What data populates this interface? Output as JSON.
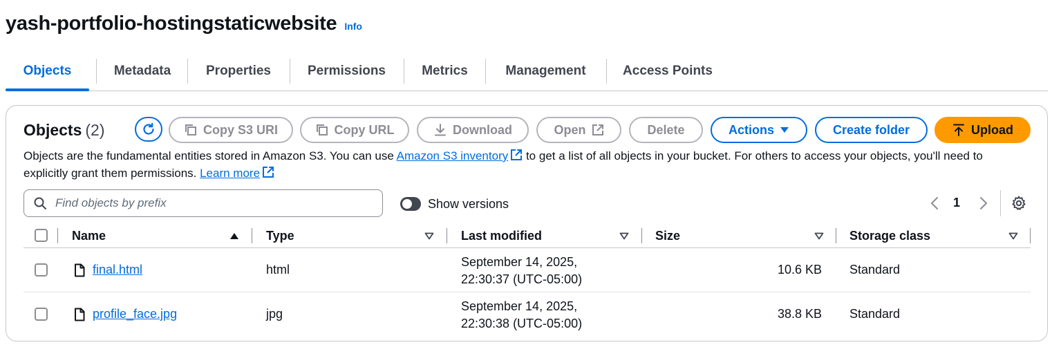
{
  "header": {
    "bucket_name": "yash-portfolio-hostingstaticwebsite",
    "info_label": "Info"
  },
  "tabs": [
    {
      "label": "Objects",
      "active": true
    },
    {
      "label": "Metadata",
      "active": false
    },
    {
      "label": "Properties",
      "active": false
    },
    {
      "label": "Permissions",
      "active": false
    },
    {
      "label": "Metrics",
      "active": false
    },
    {
      "label": "Management",
      "active": false
    },
    {
      "label": "Access Points",
      "active": false
    }
  ],
  "objects_panel": {
    "title": "Objects",
    "count": "(2)",
    "toolbar": {
      "copy_s3_uri": "Copy S3 URI",
      "copy_url": "Copy URL",
      "download": "Download",
      "open": "Open",
      "delete": "Delete",
      "actions": "Actions",
      "create_folder": "Create folder",
      "upload": "Upload"
    },
    "description": {
      "part1": "Objects are the fundamental entities stored in Amazon S3. You can use ",
      "inventory_link": "Amazon S3 inventory",
      "part2": " to get a list of all objects in your bucket. For others to access your objects, you'll need to explicitly grant them permissions. ",
      "learn_more_link": "Learn more"
    },
    "search": {
      "placeholder": "Find objects by prefix",
      "value": ""
    },
    "show_versions_label": "Show versions",
    "show_versions_on": false,
    "pagination": {
      "current_page": "1"
    },
    "columns": {
      "name": "Name",
      "type": "Type",
      "last_modified": "Last modified",
      "size": "Size",
      "storage_class": "Storage class"
    },
    "rows": [
      {
        "name": "final.html",
        "type": "html",
        "modified_line1": "September 14, 2025,",
        "modified_line2": "22:30:37 (UTC-05:00)",
        "size": "10.6 KB",
        "storage_class": "Standard"
      },
      {
        "name": "profile_face.jpg",
        "type": "jpg",
        "modified_line1": "September 14, 2025,",
        "modified_line2": "22:30:38 (UTC-05:00)",
        "size": "38.8 KB",
        "storage_class": "Standard"
      }
    ]
  },
  "colors": {
    "accent": "#006ce0",
    "upload": "#ff9900",
    "disabled": "#8c8c94",
    "text": "#0f141a"
  }
}
